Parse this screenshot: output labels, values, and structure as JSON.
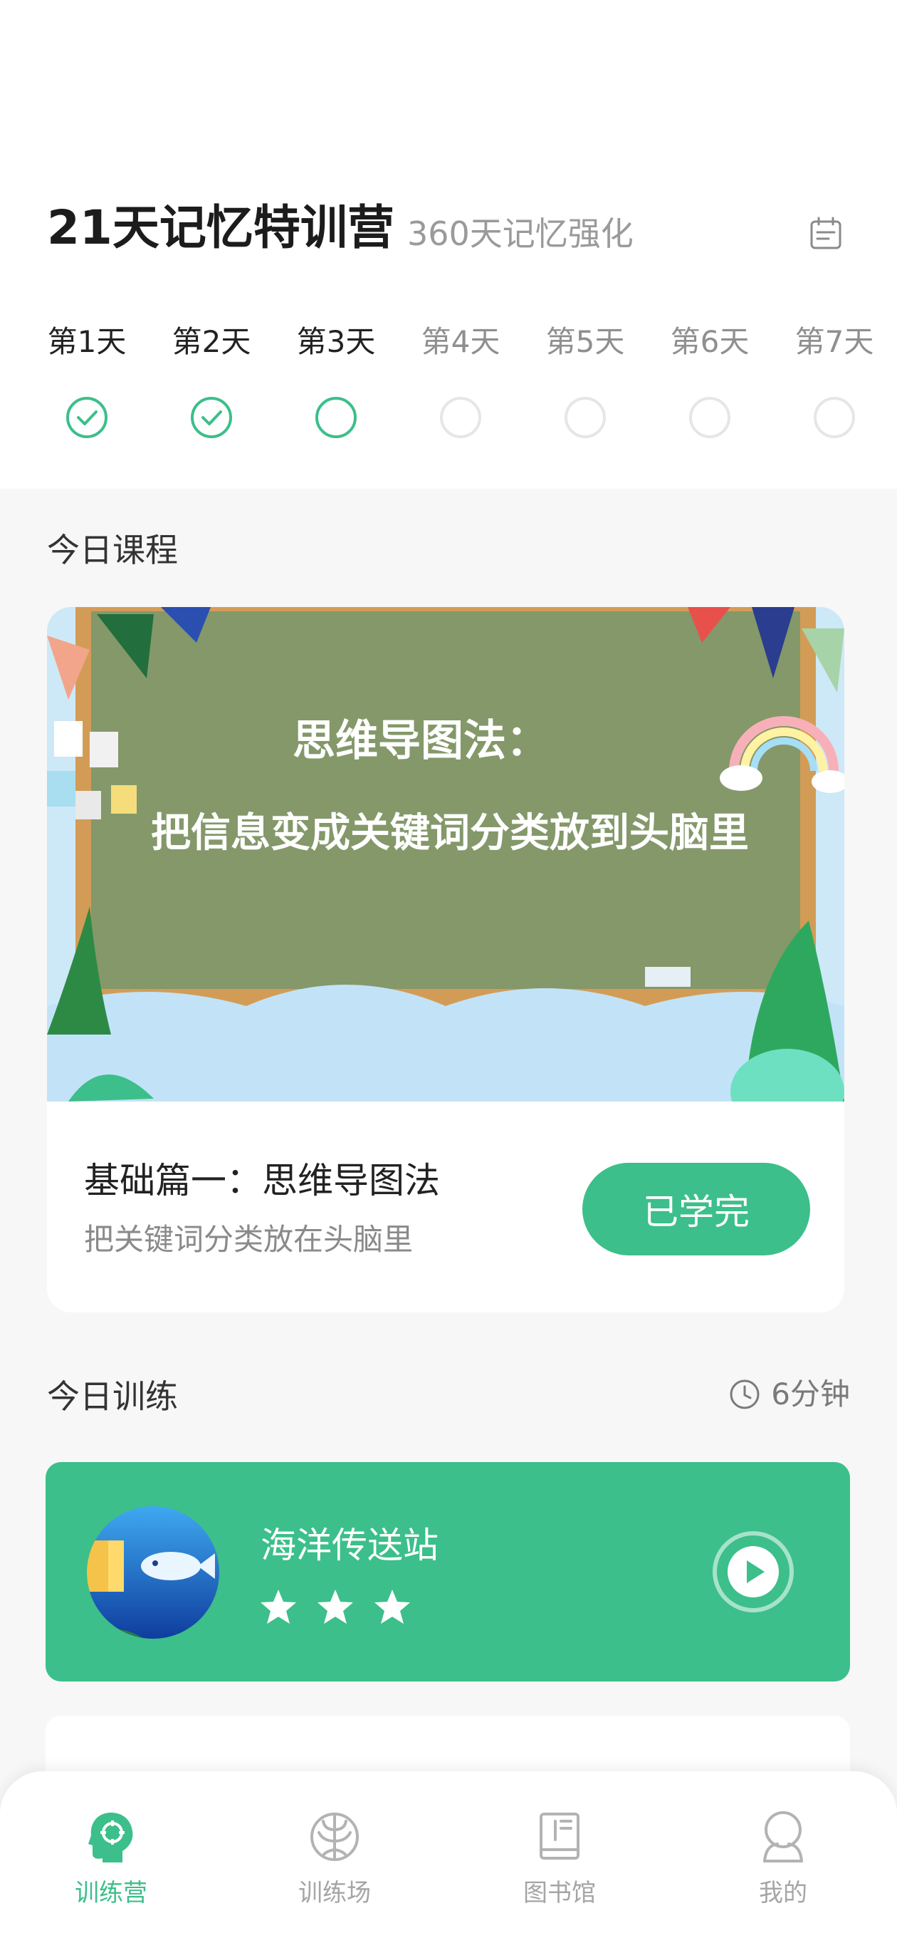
{
  "header": {
    "title": "21天记忆特训营",
    "subtitle": "360天记忆强化",
    "calendar_icon": "calendar-icon"
  },
  "days": [
    {
      "label": "第1天",
      "status": "done"
    },
    {
      "label": "第2天",
      "status": "done"
    },
    {
      "label": "第3天",
      "status": "current"
    },
    {
      "label": "第4天",
      "status": "locked"
    },
    {
      "label": "第5天",
      "status": "locked"
    },
    {
      "label": "第6天",
      "status": "locked"
    },
    {
      "label": "第7天",
      "status": "locked"
    }
  ],
  "course": {
    "section_title": "今日课程",
    "banner_title": "思维导图法：",
    "banner_subtitle": "把信息变成关键词分类放到头脑里",
    "lesson_title": "基础篇一：思维导图法",
    "lesson_sub": "把关键词分类放在头脑里",
    "status_button": "已学完"
  },
  "training": {
    "section_title": "今日训练",
    "duration": "6分钟",
    "item": {
      "name": "海洋传送站",
      "stars": 3,
      "max_stars": 3
    }
  },
  "tabs": [
    {
      "label": "训练营",
      "icon": "head-target-icon",
      "active": true
    },
    {
      "label": "训练场",
      "icon": "brain-icon",
      "active": false
    },
    {
      "label": "图书馆",
      "icon": "book-icon",
      "active": false
    },
    {
      "label": "我的",
      "icon": "user-icon",
      "active": false
    }
  ],
  "colors": {
    "accent": "#3cbf8a",
    "text_muted": "#9a9a9a"
  }
}
